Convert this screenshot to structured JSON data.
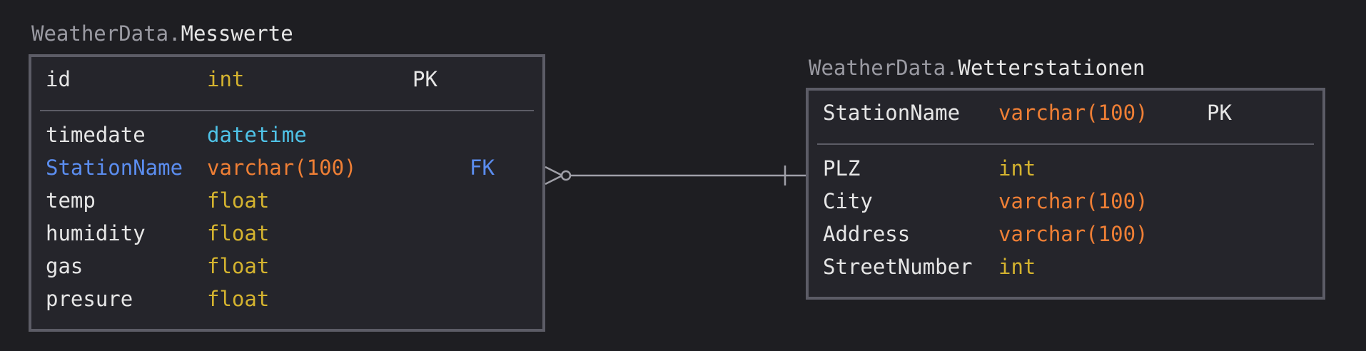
{
  "entities": {
    "messwerte": {
      "schema": "WeatherData.",
      "name": "Messwerte",
      "pk": [
        {
          "name": "id",
          "type": "int",
          "type_kind": "int",
          "key": "PK",
          "is_fk": false
        }
      ],
      "columns": [
        {
          "name": "timedate",
          "type": "datetime",
          "type_kind": "datetime",
          "key": "",
          "is_fk": false
        },
        {
          "name": "StationName",
          "type": "varchar(100)",
          "type_kind": "varchar",
          "key": "FK",
          "is_fk": true
        },
        {
          "name": "temp",
          "type": "float",
          "type_kind": "float",
          "key": "",
          "is_fk": false
        },
        {
          "name": "humidity",
          "type": "float",
          "type_kind": "float",
          "key": "",
          "is_fk": false
        },
        {
          "name": "gas",
          "type": "float",
          "type_kind": "float",
          "key": "",
          "is_fk": false
        },
        {
          "name": "presure",
          "type": "float",
          "type_kind": "float",
          "key": "",
          "is_fk": false
        }
      ]
    },
    "wetterstationen": {
      "schema": "WeatherData.",
      "name": "Wetterstationen",
      "pk": [
        {
          "name": "StationName",
          "type": "varchar(100)",
          "type_kind": "varchar",
          "key": "PK",
          "is_fk": false
        }
      ],
      "columns": [
        {
          "name": "PLZ",
          "type": "int",
          "type_kind": "int",
          "key": "",
          "is_fk": false
        },
        {
          "name": "City",
          "type": "varchar(100)",
          "type_kind": "varchar",
          "key": "",
          "is_fk": false
        },
        {
          "name": "Address",
          "type": "varchar(100)",
          "type_kind": "varchar",
          "key": "",
          "is_fk": false
        },
        {
          "name": "StreetNumber",
          "type": "int",
          "type_kind": "int",
          "key": "",
          "is_fk": false
        }
      ]
    }
  },
  "relationship": {
    "from": "Messwerte.StationName",
    "to": "Wetterstationen.StationName",
    "from_cardinality": "zero-or-many",
    "to_cardinality": "one"
  },
  "colors": {
    "background": "#1e1e22",
    "box_fill": "#25252b",
    "box_border": "#5c5c66",
    "text": "#e6e6e6",
    "schema_text": "#9a9aa2",
    "fk": "#5b8def",
    "type_int_float": "#d4b32f",
    "type_varchar": "#ef7f35",
    "type_datetime": "#4fc3e8",
    "connector": "#a0a0a8"
  }
}
